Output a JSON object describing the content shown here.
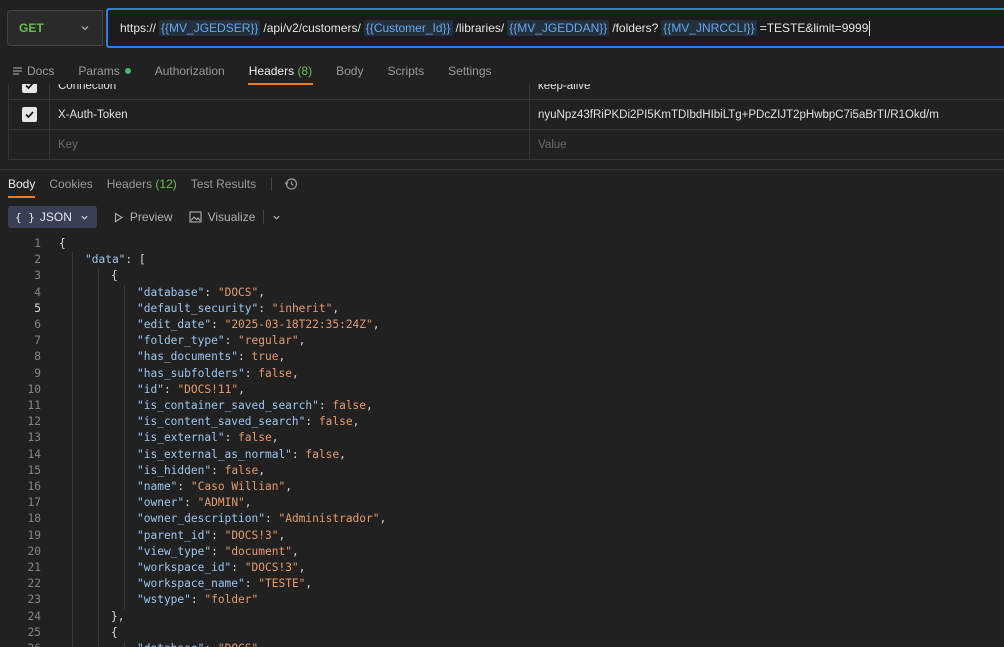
{
  "request": {
    "method": "GET",
    "url": {
      "prefix": "https://",
      "var1": "{{MV_JGEDSER}}",
      "seg1": "/api/v2/customers/",
      "var2": "{{Customer_Id}}",
      "seg2": "/libraries/",
      "var3": "{{MV_JGEDDAN}}",
      "seg3": "/folders?",
      "var4": "{{MV_JNRCCLI}}",
      "suffix": "=TESTE&limit=9999"
    }
  },
  "request_tabs": {
    "docs": "Docs",
    "params": "Params",
    "authorization": "Authorization",
    "headers": "Headers",
    "headers_count": "(8)",
    "body": "Body",
    "scripts": "Scripts",
    "settings": "Settings"
  },
  "headers_table": {
    "rows": [
      {
        "key": "Connection",
        "value": "keep-alive"
      },
      {
        "key": "X-Auth-Token",
        "value": "nyuNpz43fRiPKDi2PI5KmTDIbdHIbiLTg+PDcZIJT2pHwbpC7i5aBrTI/R1Okd/m"
      }
    ],
    "key_placeholder": "Key",
    "value_placeholder": "Value"
  },
  "response_tabs": {
    "body": "Body",
    "cookies": "Cookies",
    "headers": "Headers",
    "headers_count": "(12)",
    "test_results": "Test Results"
  },
  "format_bar": {
    "format": "JSON",
    "braces": "{ }",
    "preview": "Preview",
    "visualize": "Visualize"
  },
  "code": {
    "current_line": 5,
    "lines": [
      {
        "n": "1",
        "indent": 0,
        "parts": [
          [
            "p",
            "{"
          ]
        ]
      },
      {
        "n": "2",
        "indent": 1,
        "parts": [
          [
            "k",
            "\"data\""
          ],
          [
            "p",
            ": ["
          ]
        ]
      },
      {
        "n": "3",
        "indent": 2,
        "parts": [
          [
            "p",
            "{"
          ]
        ]
      },
      {
        "n": "4",
        "indent": 3,
        "parts": [
          [
            "k",
            "\"database\""
          ],
          [
            "p",
            ": "
          ],
          [
            "s",
            "\"DOCS\""
          ],
          [
            "p",
            ","
          ]
        ]
      },
      {
        "n": "5",
        "indent": 3,
        "parts": [
          [
            "k",
            "\"default_security\""
          ],
          [
            "p",
            ": "
          ],
          [
            "s",
            "\"inherit\""
          ],
          [
            "p",
            ","
          ]
        ]
      },
      {
        "n": "6",
        "indent": 3,
        "parts": [
          [
            "k",
            "\"edit_date\""
          ],
          [
            "p",
            ": "
          ],
          [
            "s",
            "\"2025-03-18T22:35:24Z\""
          ],
          [
            "p",
            ","
          ]
        ]
      },
      {
        "n": "7",
        "indent": 3,
        "parts": [
          [
            "k",
            "\"folder_type\""
          ],
          [
            "p",
            ": "
          ],
          [
            "s",
            "\"regular\""
          ],
          [
            "p",
            ","
          ]
        ]
      },
      {
        "n": "8",
        "indent": 3,
        "parts": [
          [
            "k",
            "\"has_documents\""
          ],
          [
            "p",
            ": "
          ],
          [
            "b",
            "true"
          ],
          [
            "p",
            ","
          ]
        ]
      },
      {
        "n": "9",
        "indent": 3,
        "parts": [
          [
            "k",
            "\"has_subfolders\""
          ],
          [
            "p",
            ": "
          ],
          [
            "b",
            "false"
          ],
          [
            "p",
            ","
          ]
        ]
      },
      {
        "n": "10",
        "indent": 3,
        "parts": [
          [
            "k",
            "\"id\""
          ],
          [
            "p",
            ": "
          ],
          [
            "s",
            "\"DOCS!11\""
          ],
          [
            "p",
            ","
          ]
        ]
      },
      {
        "n": "11",
        "indent": 3,
        "parts": [
          [
            "k",
            "\"is_container_saved_search\""
          ],
          [
            "p",
            ": "
          ],
          [
            "b",
            "false"
          ],
          [
            "p",
            ","
          ]
        ]
      },
      {
        "n": "12",
        "indent": 3,
        "parts": [
          [
            "k",
            "\"is_content_saved_search\""
          ],
          [
            "p",
            ": "
          ],
          [
            "b",
            "false"
          ],
          [
            "p",
            ","
          ]
        ]
      },
      {
        "n": "13",
        "indent": 3,
        "parts": [
          [
            "k",
            "\"is_external\""
          ],
          [
            "p",
            ": "
          ],
          [
            "b",
            "false"
          ],
          [
            "p",
            ","
          ]
        ]
      },
      {
        "n": "14",
        "indent": 3,
        "parts": [
          [
            "k",
            "\"is_external_as_normal\""
          ],
          [
            "p",
            ": "
          ],
          [
            "b",
            "false"
          ],
          [
            "p",
            ","
          ]
        ]
      },
      {
        "n": "15",
        "indent": 3,
        "parts": [
          [
            "k",
            "\"is_hidden\""
          ],
          [
            "p",
            ": "
          ],
          [
            "b",
            "false"
          ],
          [
            "p",
            ","
          ]
        ]
      },
      {
        "n": "16",
        "indent": 3,
        "parts": [
          [
            "k",
            "\"name\""
          ],
          [
            "p",
            ": "
          ],
          [
            "s",
            "\"Caso Willian\""
          ],
          [
            "p",
            ","
          ]
        ]
      },
      {
        "n": "17",
        "indent": 3,
        "parts": [
          [
            "k",
            "\"owner\""
          ],
          [
            "p",
            ": "
          ],
          [
            "s",
            "\"ADMIN\""
          ],
          [
            "p",
            ","
          ]
        ]
      },
      {
        "n": "18",
        "indent": 3,
        "parts": [
          [
            "k",
            "\"owner_description\""
          ],
          [
            "p",
            ": "
          ],
          [
            "s",
            "\"Administrador\""
          ],
          [
            "p",
            ","
          ]
        ]
      },
      {
        "n": "19",
        "indent": 3,
        "parts": [
          [
            "k",
            "\"parent_id\""
          ],
          [
            "p",
            ": "
          ],
          [
            "s",
            "\"DOCS!3\""
          ],
          [
            "p",
            ","
          ]
        ]
      },
      {
        "n": "20",
        "indent": 3,
        "parts": [
          [
            "k",
            "\"view_type\""
          ],
          [
            "p",
            ": "
          ],
          [
            "s",
            "\"document\""
          ],
          [
            "p",
            ","
          ]
        ]
      },
      {
        "n": "21",
        "indent": 3,
        "parts": [
          [
            "k",
            "\"workspace_id\""
          ],
          [
            "p",
            ": "
          ],
          [
            "s",
            "\"DOCS!3\""
          ],
          [
            "p",
            ","
          ]
        ]
      },
      {
        "n": "22",
        "indent": 3,
        "parts": [
          [
            "k",
            "\"workspace_name\""
          ],
          [
            "p",
            ": "
          ],
          [
            "s",
            "\"TESTE\""
          ],
          [
            "p",
            ","
          ]
        ]
      },
      {
        "n": "23",
        "indent": 3,
        "parts": [
          [
            "k",
            "\"wstype\""
          ],
          [
            "p",
            ": "
          ],
          [
            "s",
            "\"folder\""
          ]
        ]
      },
      {
        "n": "24",
        "indent": 2,
        "parts": [
          [
            "p",
            "},"
          ]
        ]
      },
      {
        "n": "25",
        "indent": 2,
        "parts": [
          [
            "p",
            "{"
          ]
        ]
      },
      {
        "n": "26",
        "indent": 3,
        "parts": [
          [
            "k",
            "\"database\""
          ],
          [
            "p",
            ": "
          ],
          [
            "s",
            "\"DOCS\""
          ],
          [
            "p",
            ","
          ]
        ]
      }
    ]
  }
}
